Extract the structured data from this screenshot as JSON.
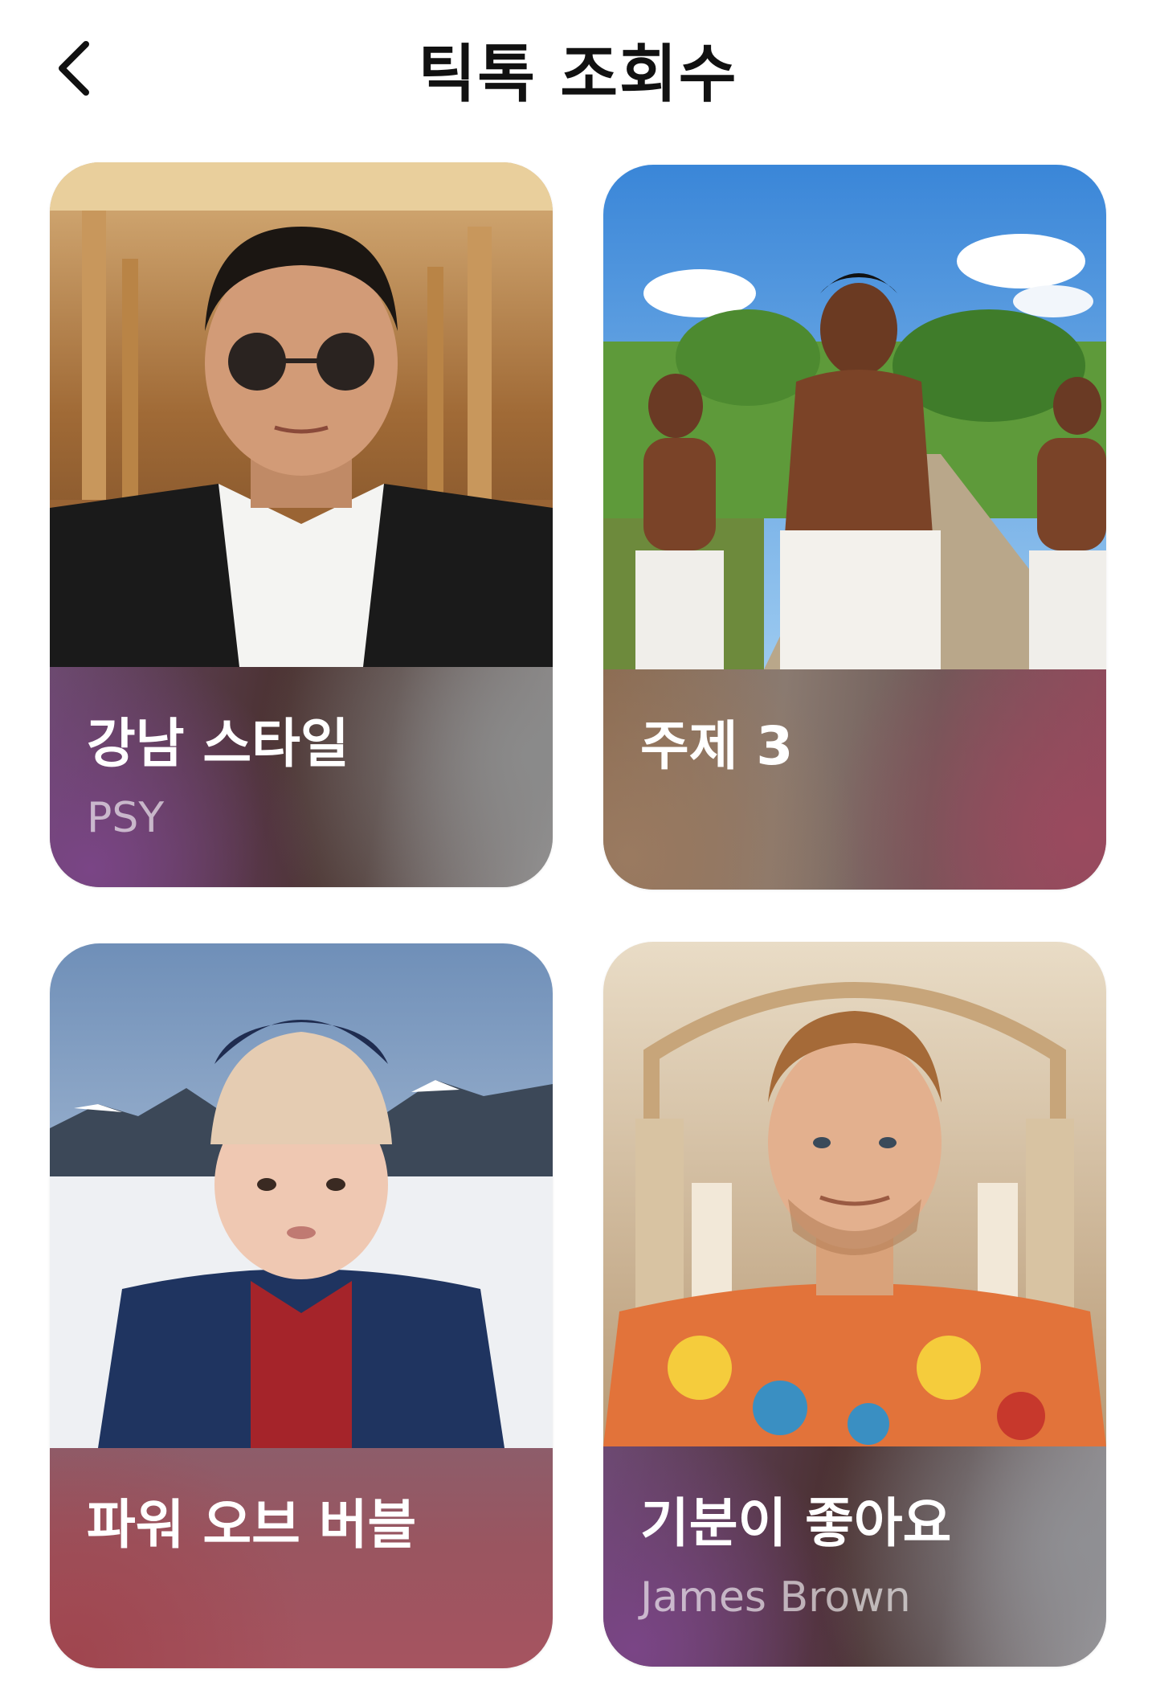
{
  "header": {
    "title": "틱톡 조회수",
    "back_icon": "chevron-left-icon"
  },
  "cards": [
    {
      "title": "강남 스타일",
      "subtitle": "PSY",
      "image": "man-with-round-sunglasses-in-golden-palace"
    },
    {
      "title": "주제 3",
      "subtitle": "",
      "image": "shirtless-men-dancing-outdoors"
    },
    {
      "title": "파워 오브 버블",
      "subtitle": "",
      "image": "child-in-knit-hat-snowy-mountains"
    },
    {
      "title": "기분이 좋아요",
      "subtitle": "James Brown",
      "image": "man-in-floral-shirt-in-palace-hall"
    }
  ],
  "colors": {
    "background": "#ffffff",
    "title_text": "#111111",
    "card_title": "#ffffff",
    "card_subtitle": "#c9bcc4"
  }
}
